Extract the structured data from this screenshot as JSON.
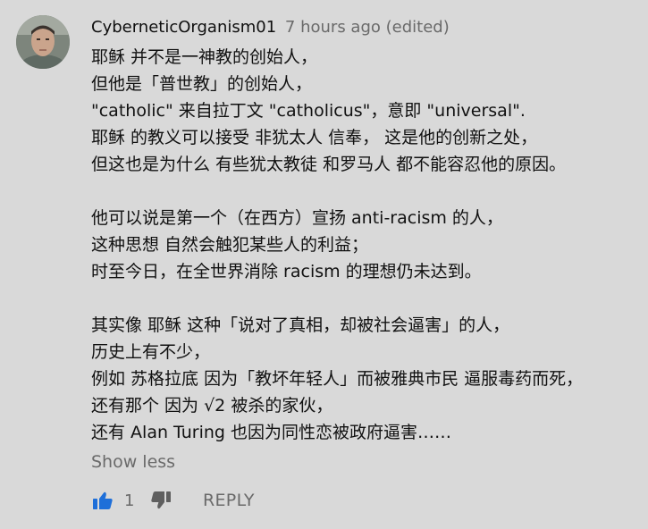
{
  "comment": {
    "author": "CyberneticOrganism01",
    "timestamp": "7 hours ago (edited)",
    "paragraphs": [
      [
        "耶稣 并不是一神教的创始人，",
        "但他是「普世教」的创始人，",
        "\"catholic\" 来自拉丁文 \"catholicus\"，意即 \"universal\".",
        "耶稣 的教义可以接受 非犹太人 信奉， 这是他的创新之处，",
        "但这也是为什么 有些犹太教徒 和罗马人 都不能容忍他的原因。"
      ],
      [
        "他可以说是第一个（在西方）宣扬 anti-racism 的人，",
        "这种思想 自然会触犯某些人的利益；",
        "时至今日，在全世界消除 racism 的理想仍未达到。"
      ],
      [
        "其实像 耶稣 这种「说对了真相，却被社会逼害」的人，",
        "历史上有不少，",
        "例如 苏格拉底 因为「教坏年轻人」而被雅典市民 逼服毒药而死，",
        "还有那个 因为 √2 被杀的家伙，",
        "还有 Alan Turing 也因为同性恋被政府逼害……"
      ]
    ],
    "show_less_label": "Show less",
    "like_count": "1",
    "reply_label": "REPLY"
  },
  "icons": {
    "like": "thumbs-up-icon",
    "dislike": "thumbs-down-icon"
  },
  "colors": {
    "background": "#d9d9d9",
    "text": "#111111",
    "muted": "#6a6a6a",
    "like_active": "#1e6fd9",
    "dislike": "#5f5f5f"
  }
}
